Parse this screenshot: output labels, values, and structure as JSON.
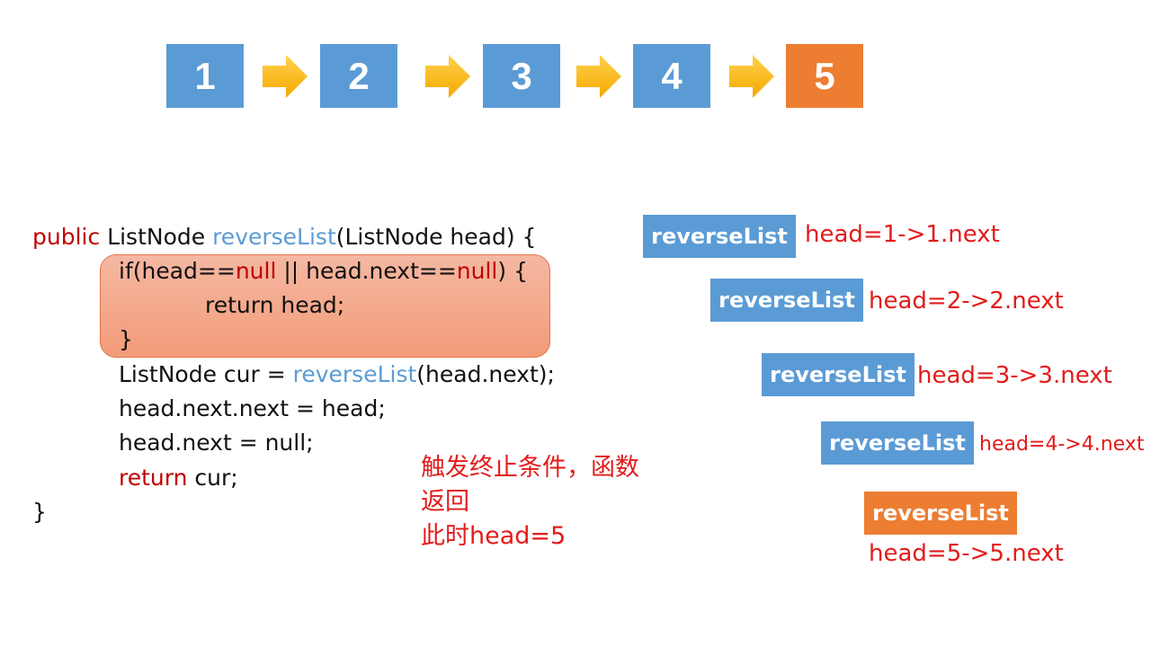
{
  "colors": {
    "node_blue": "#5b9bd5",
    "node_orange": "#ed7d31",
    "arrow_yellow": "#ffc000",
    "keyword_red": "#c00000",
    "function_blue": "#5b9bd5",
    "annotation_red": "#e31b1b",
    "highlight_fill": "#f4a486"
  },
  "linked_list": {
    "nodes": [
      {
        "label": "1",
        "color": "#5b9bd5"
      },
      {
        "label": "2",
        "color": "#5b9bd5"
      },
      {
        "label": "3",
        "color": "#5b9bd5"
      },
      {
        "label": "4",
        "color": "#5b9bd5"
      },
      {
        "label": "5",
        "color": "#ed7d31"
      }
    ],
    "arrow_icon": "right-arrow-icon"
  },
  "code": {
    "line1": {
      "a": "public",
      "b": " ListNode ",
      "c": "reverseList",
      "d": "(ListNode head) {"
    },
    "line2": {
      "a": "if(head==",
      "b": "null",
      "c": " || head.next==",
      "d": "null",
      "e": ") {"
    },
    "line3": "return head;",
    "line4": "}",
    "line5": {
      "a": "ListNode cur = ",
      "b": "reverseList",
      "c": "(head.next);"
    },
    "line6": "head.next.next = head;",
    "line7": "head.next = null;",
    "line8": {
      "a": "return",
      "b": " cur;"
    },
    "line9": "}"
  },
  "annotation": {
    "line1": "触发终止条件，函数",
    "line2": "返回",
    "line3": "此时head=5"
  },
  "call_stack": {
    "frames": [
      {
        "label": "reverseList",
        "detail": "head=1->1.next",
        "color": "#5b9bd5"
      },
      {
        "label": "reverseList",
        "detail": "head=2->2.next",
        "color": "#5b9bd5"
      },
      {
        "label": "reverseList",
        "detail": "head=3->3.next",
        "color": "#5b9bd5"
      },
      {
        "label": "reverseList",
        "detail": "head=4->4.next",
        "color": "#5b9bd5"
      },
      {
        "label": "reverseList",
        "detail": "head=5->5.next",
        "color": "#ed7d31"
      }
    ]
  }
}
